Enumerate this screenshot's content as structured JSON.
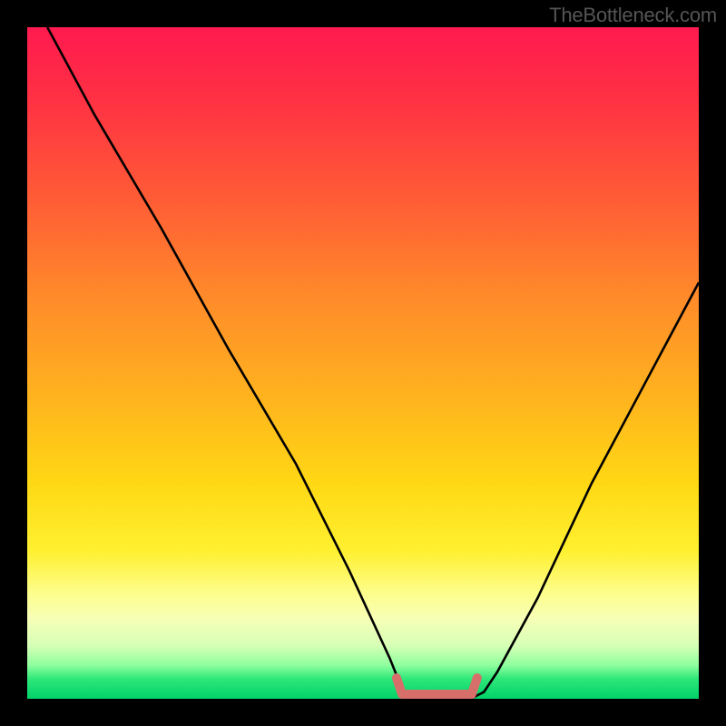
{
  "watermark": "TheBottleneck.com",
  "chart_data": {
    "type": "line",
    "title": "",
    "xlabel": "",
    "ylabel": "",
    "xlim": [
      0,
      100
    ],
    "ylim": [
      0,
      100
    ],
    "series": [
      {
        "name": "curve",
        "x": [
          3,
          10,
          20,
          30,
          40,
          48,
          54,
          56,
          60,
          66,
          68,
          70,
          76,
          84,
          92,
          100
        ],
        "y": [
          100,
          87,
          70,
          52,
          35,
          19,
          6,
          1,
          0,
          0,
          1,
          4,
          15,
          32,
          47,
          62
        ]
      }
    ],
    "annotations": [
      {
        "type": "highlight",
        "shape": "valley-marker",
        "x_start": 55,
        "x_end": 67,
        "y": 0,
        "color": "#d66f6a"
      }
    ],
    "background": {
      "type": "vertical-gradient",
      "direction": "top-to-bottom",
      "stops": [
        {
          "pos": 0,
          "color": "#ff1a4f"
        },
        {
          "pos": 25,
          "color": "#ff5a36"
        },
        {
          "pos": 55,
          "color": "#ffb31e"
        },
        {
          "pos": 78,
          "color": "#fff030"
        },
        {
          "pos": 92,
          "color": "#d8ffb7"
        },
        {
          "pos": 100,
          "color": "#00d268"
        }
      ]
    }
  }
}
